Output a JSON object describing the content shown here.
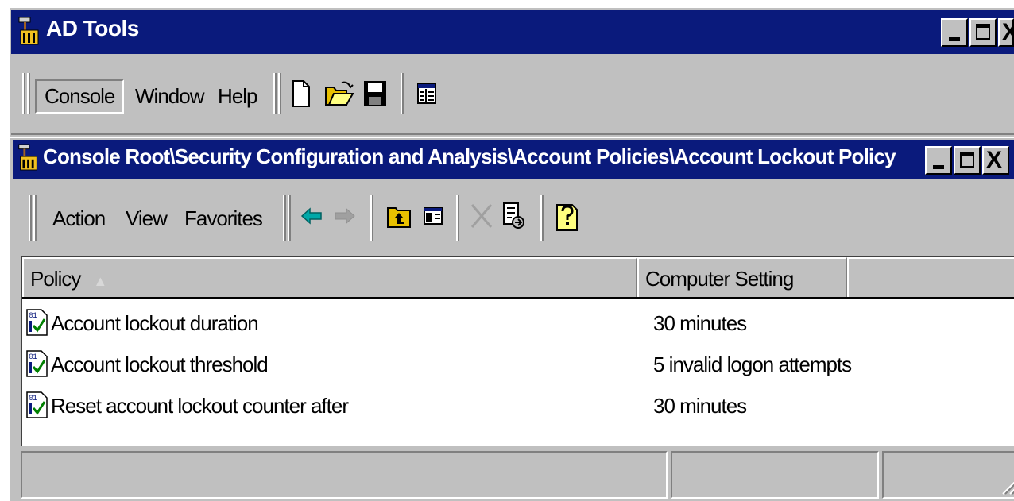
{
  "app": {
    "title": "AD Tools",
    "accent_color": "#0a1a7c",
    "face_color": "#c0c0c0"
  },
  "main_menu": {
    "items": [
      "Console",
      "Window",
      "Help"
    ]
  },
  "main_toolbar": {
    "icons": [
      "new-document-icon",
      "open-folder-icon",
      "save-icon",
      "console-tree-icon"
    ]
  },
  "child_window": {
    "title": "Console Root\\Security Configuration and Analysis\\Account Policies\\Account Lockout Policy"
  },
  "child_menu": {
    "items": [
      "Action",
      "View",
      "Favorites"
    ]
  },
  "child_toolbar": {
    "icons": [
      "back-arrow-icon",
      "forward-arrow-icon",
      "up-one-level-icon",
      "show-hide-tree-icon",
      "delete-icon",
      "export-list-icon",
      "help-icon"
    ]
  },
  "list": {
    "columns": [
      "Policy",
      "Computer Setting"
    ],
    "sort_indicator": "▲",
    "rows": [
      {
        "policy": "Account lockout duration",
        "setting": "30 minutes"
      },
      {
        "policy": "Account lockout threshold",
        "setting": "5 invalid logon attempts"
      },
      {
        "policy": "Reset account lockout counter after",
        "setting": "30 minutes"
      }
    ]
  }
}
